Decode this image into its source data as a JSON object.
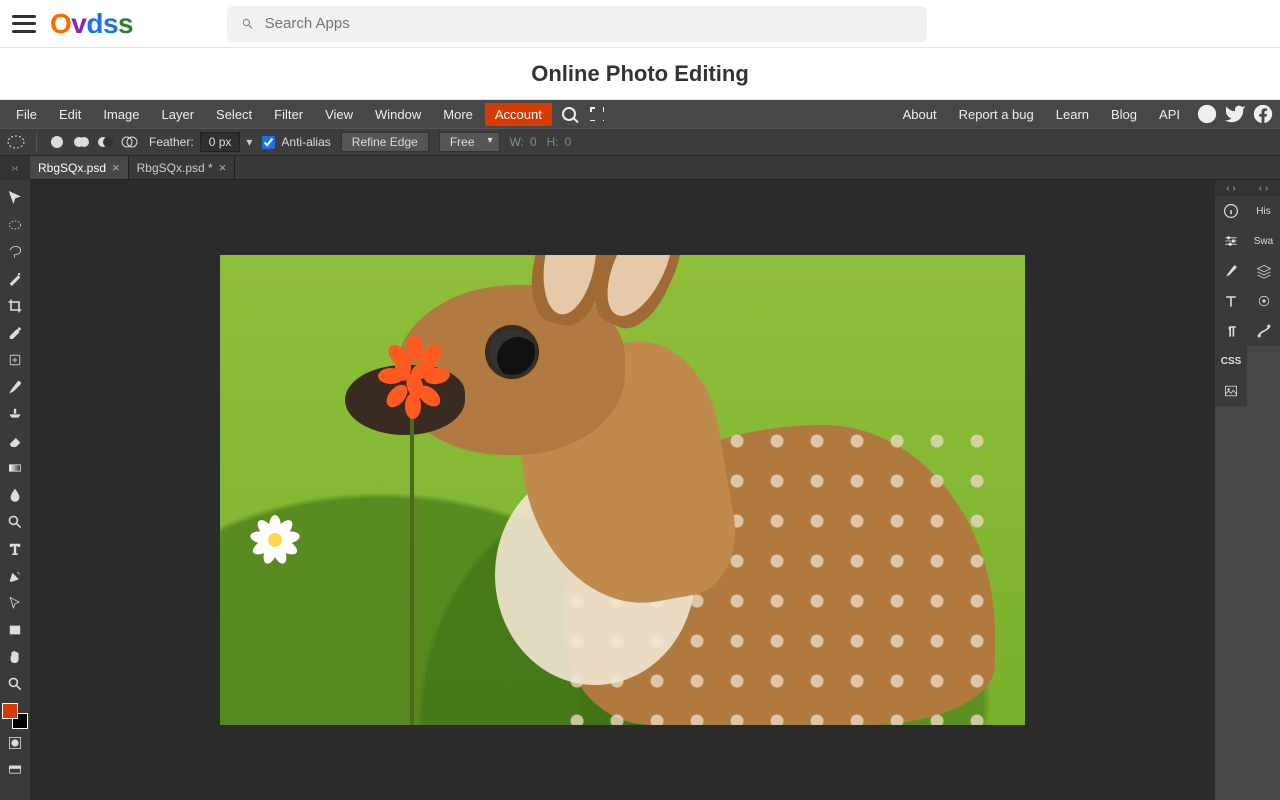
{
  "topbar": {
    "logo_chars": [
      "O",
      "v",
      "d",
      "s",
      "s"
    ],
    "search_placeholder": "Search Apps"
  },
  "page_title": "Online Photo Editing",
  "menu": {
    "items": [
      "File",
      "Edit",
      "Image",
      "Layer",
      "Select",
      "Filter",
      "View",
      "Window",
      "More",
      "Account"
    ],
    "right": [
      "About",
      "Report a bug",
      "Learn",
      "Blog",
      "API"
    ]
  },
  "options": {
    "feather_label": "Feather:",
    "feather_value": "0 px",
    "antialias_label": "Anti-alias",
    "antialias_checked": true,
    "refine_label": "Refine Edge",
    "mode_value": "Free",
    "w_label": "W:",
    "w_value": "0",
    "h_label": "H:",
    "h_value": "0"
  },
  "tabs": [
    {
      "label": "RbgSQx.psd",
      "dirty": false,
      "active": true
    },
    {
      "label": "RbgSQx.psd *",
      "dirty": true,
      "active": false
    }
  ],
  "right_panels_a": [
    "info",
    "adjust",
    "brush",
    "type",
    "paragraph",
    "css",
    "image"
  ],
  "right_panels_b": [
    {
      "label": "His"
    },
    {
      "label": "Swa"
    },
    {
      "icon": "layers"
    },
    {
      "icon": "channels"
    },
    {
      "icon": "paths"
    }
  ],
  "tools": [
    "move",
    "marquee-ellipse",
    "lasso",
    "wand",
    "crop",
    "eyedropper",
    "healing",
    "brush",
    "stamp",
    "eraser",
    "gradient",
    "blur",
    "dodge",
    "text",
    "pen",
    "path-select",
    "rectangle",
    "hand",
    "zoom"
  ],
  "canvas_subject": "Young deer (fawn) in green grass with orange wildflower and white daisy"
}
